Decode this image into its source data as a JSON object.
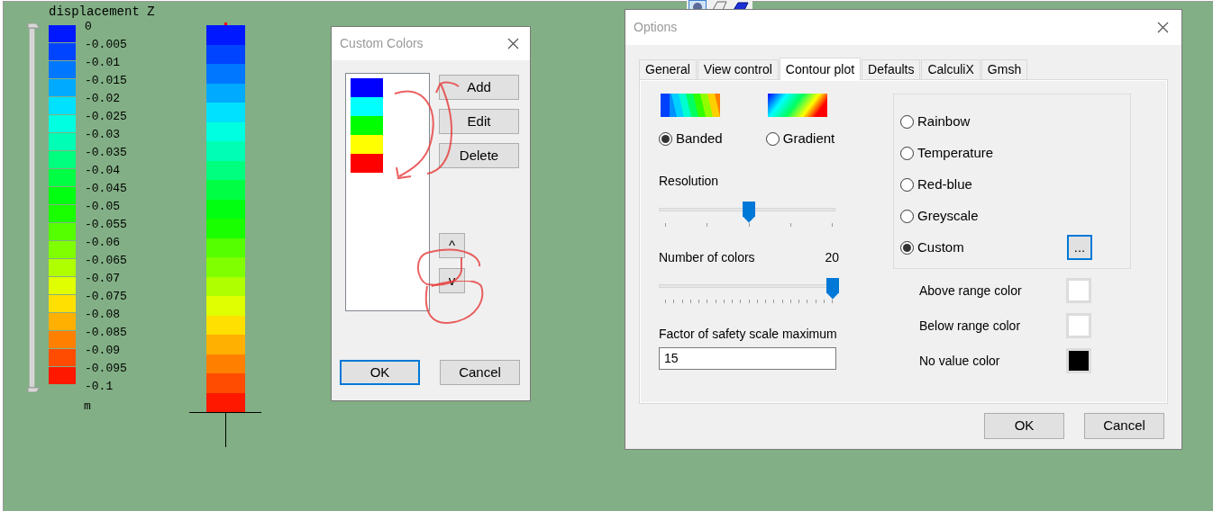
{
  "legend": {
    "title": "displacement Z",
    "labels": [
      "0",
      "-0.005",
      "-0.01",
      "-0.015",
      "-0.02",
      "-0.025",
      "-0.03",
      "-0.035",
      "-0.04",
      "-0.045",
      "-0.05",
      "-0.055",
      "-0.06",
      "-0.065",
      "-0.07",
      "-0.075",
      "-0.08",
      "-0.085",
      "-0.09",
      "-0.095",
      "-0.1"
    ],
    "bands": [
      {
        "color": "#0018ff"
      },
      {
        "color": "#0044ff"
      },
      {
        "color": "#0077ff"
      },
      {
        "color": "#00aaff"
      },
      {
        "color": "#00e0ff"
      },
      {
        "color": "#00ffe0"
      },
      {
        "color": "#00ffb4"
      },
      {
        "color": "#00ff7f"
      },
      {
        "color": "#00ff44"
      },
      {
        "color": "#00ff10"
      },
      {
        "color": "#1aff00"
      },
      {
        "color": "#55ff00"
      },
      {
        "color": "#80ff00"
      },
      {
        "color": "#b0ff00"
      },
      {
        "color": "#e0ff00"
      },
      {
        "color": "#ffe000"
      },
      {
        "color": "#ffb000"
      },
      {
        "color": "#ff8000"
      },
      {
        "color": "#ff4c00"
      },
      {
        "color": "#ff1800"
      }
    ],
    "unit": "m",
    "range_slider": {
      "level": 1
    }
  },
  "custom_colors": {
    "title": "Custom Colors",
    "colors": [
      {
        "color": "#0000ff"
      },
      {
        "color": "#00ffff"
      },
      {
        "color": "#00ff00"
      },
      {
        "color": "#ffff00"
      },
      {
        "color": "#ff0000"
      }
    ],
    "side_buttons": [
      "Add",
      "Edit",
      "Delete"
    ],
    "move_buttons": [
      "^",
      "v"
    ],
    "buttons": [
      {
        "label": "OK",
        "focused": true
      },
      {
        "label": "Cancel",
        "focused": false
      }
    ]
  },
  "options": {
    "title": "Options",
    "tabs": [
      {
        "label": "General",
        "selected": false
      },
      {
        "label": "View control",
        "selected": false
      },
      {
        "label": "Contour plot",
        "selected": true
      },
      {
        "label": "Defaults",
        "selected": false
      },
      {
        "label": "CalculiX",
        "selected": false
      },
      {
        "label": "Gmsh",
        "selected": false
      }
    ],
    "style_radios": [
      {
        "label": "Banded",
        "kind": "banded",
        "selected": true
      },
      {
        "label": "Gradient",
        "kind": "gradient",
        "selected": false
      }
    ],
    "resolution": {
      "label": "Resolution",
      "level": 0.5
    },
    "number_of_colors": {
      "label": "Number of colors",
      "value": "20",
      "level": 1
    },
    "factor": {
      "label": "Factor of safety scale maximum",
      "value": "15"
    },
    "schemes": [
      {
        "label": "Rainbow",
        "selected": false
      },
      {
        "label": "Temperature",
        "selected": false
      },
      {
        "label": "Red-blue",
        "selected": false
      },
      {
        "label": "Greyscale",
        "selected": false
      },
      {
        "label": "Custom",
        "selected": true
      }
    ],
    "custom_button": {
      "label": "...",
      "focused": true
    },
    "range_colors": [
      {
        "label": "Above range color",
        "color": "#ffffff"
      },
      {
        "label": "Below range color",
        "color": "#ffffff"
      },
      {
        "label": "No value color",
        "color": "#000000"
      }
    ],
    "buttons": [
      {
        "label": "OK",
        "focused": false
      },
      {
        "label": "Cancel",
        "focused": false
      }
    ]
  }
}
